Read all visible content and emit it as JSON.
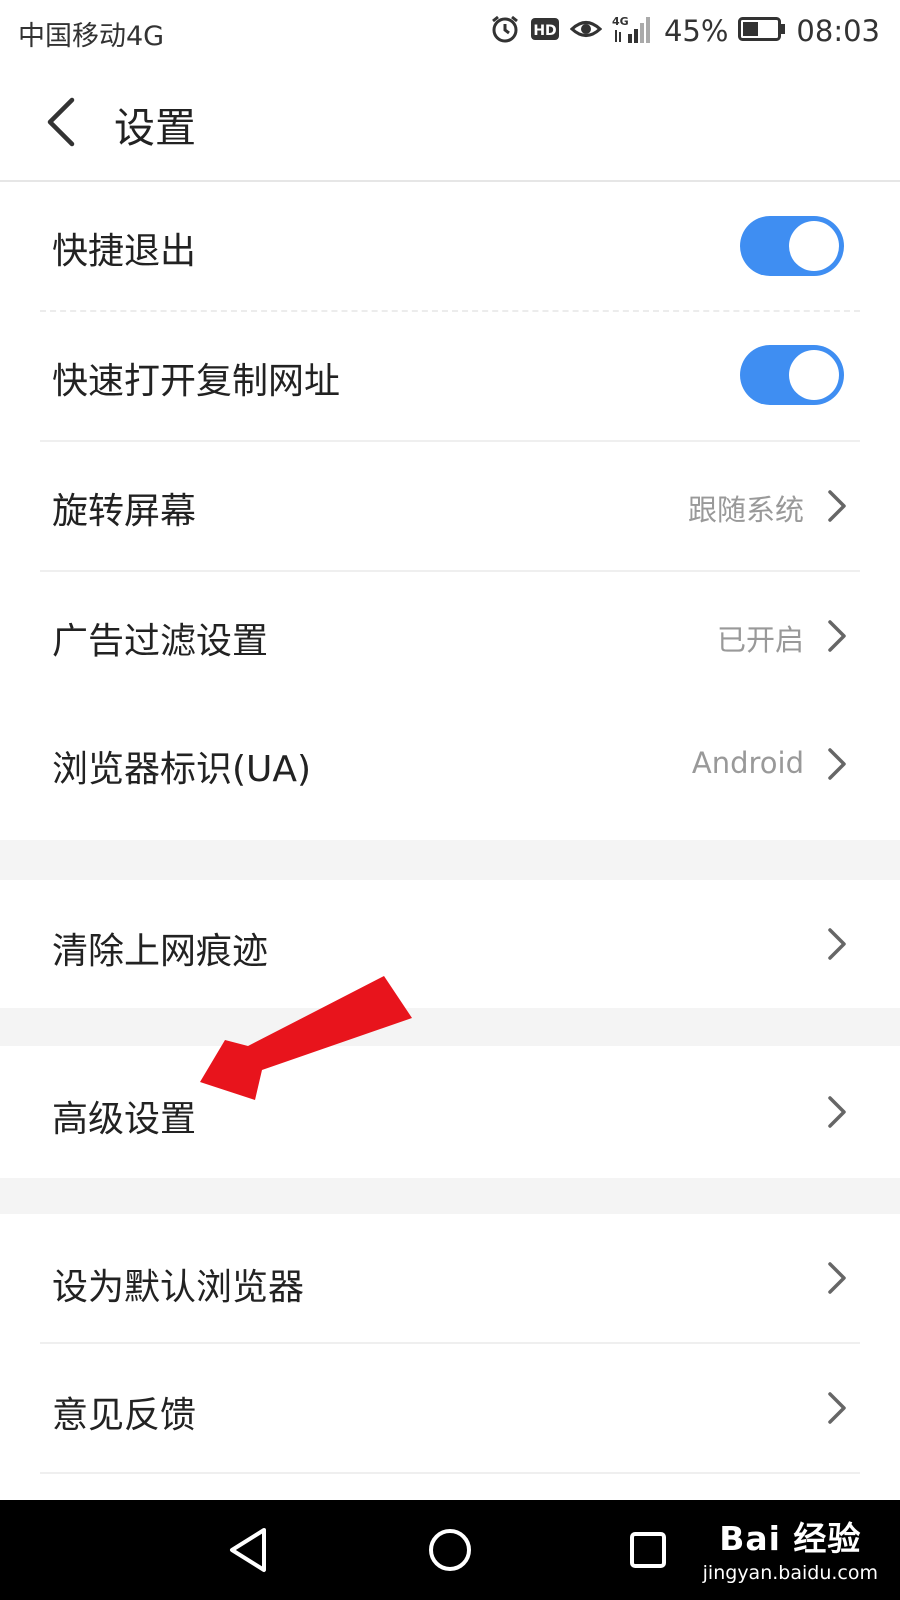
{
  "status_bar": {
    "carrier": "中国移动4G",
    "battery_pct": "45%",
    "battery_level": 0.45,
    "time": "08:03",
    "icons": [
      "alarm-icon",
      "hd-icon",
      "eye-icon",
      "signal-4g-icon",
      "battery-icon"
    ]
  },
  "header": {
    "title": "设置",
    "back_icon": "chevron-left-icon"
  },
  "settings": {
    "quick_exit": {
      "label": "快捷退出",
      "enabled": true
    },
    "quick_open_url": {
      "label": "快速打开复制网址",
      "enabled": true
    },
    "rotate_screen": {
      "label": "旋转屏幕",
      "value": "跟随系统"
    },
    "ad_filter": {
      "label": "广告过滤设置",
      "value": "已开启"
    },
    "user_agent": {
      "label": "浏览器标识(UA)",
      "value": "Android"
    },
    "clear_history": {
      "label": "清除上网痕迹"
    },
    "advanced": {
      "label": "高级设置"
    },
    "default_browser": {
      "label": "设为默认浏览器"
    },
    "feedback": {
      "label": "意见反馈"
    }
  },
  "nav_bar": {
    "buttons": [
      "back-triangle-icon",
      "home-circle-icon",
      "recents-square-icon"
    ]
  },
  "watermark": {
    "logo": "Bai 经验",
    "url": "jingyan.baidu.com"
  },
  "colors": {
    "toggle_on": "#3f8ef2",
    "arrow": "#e8141c",
    "section_gap": "#f4f4f4"
  }
}
